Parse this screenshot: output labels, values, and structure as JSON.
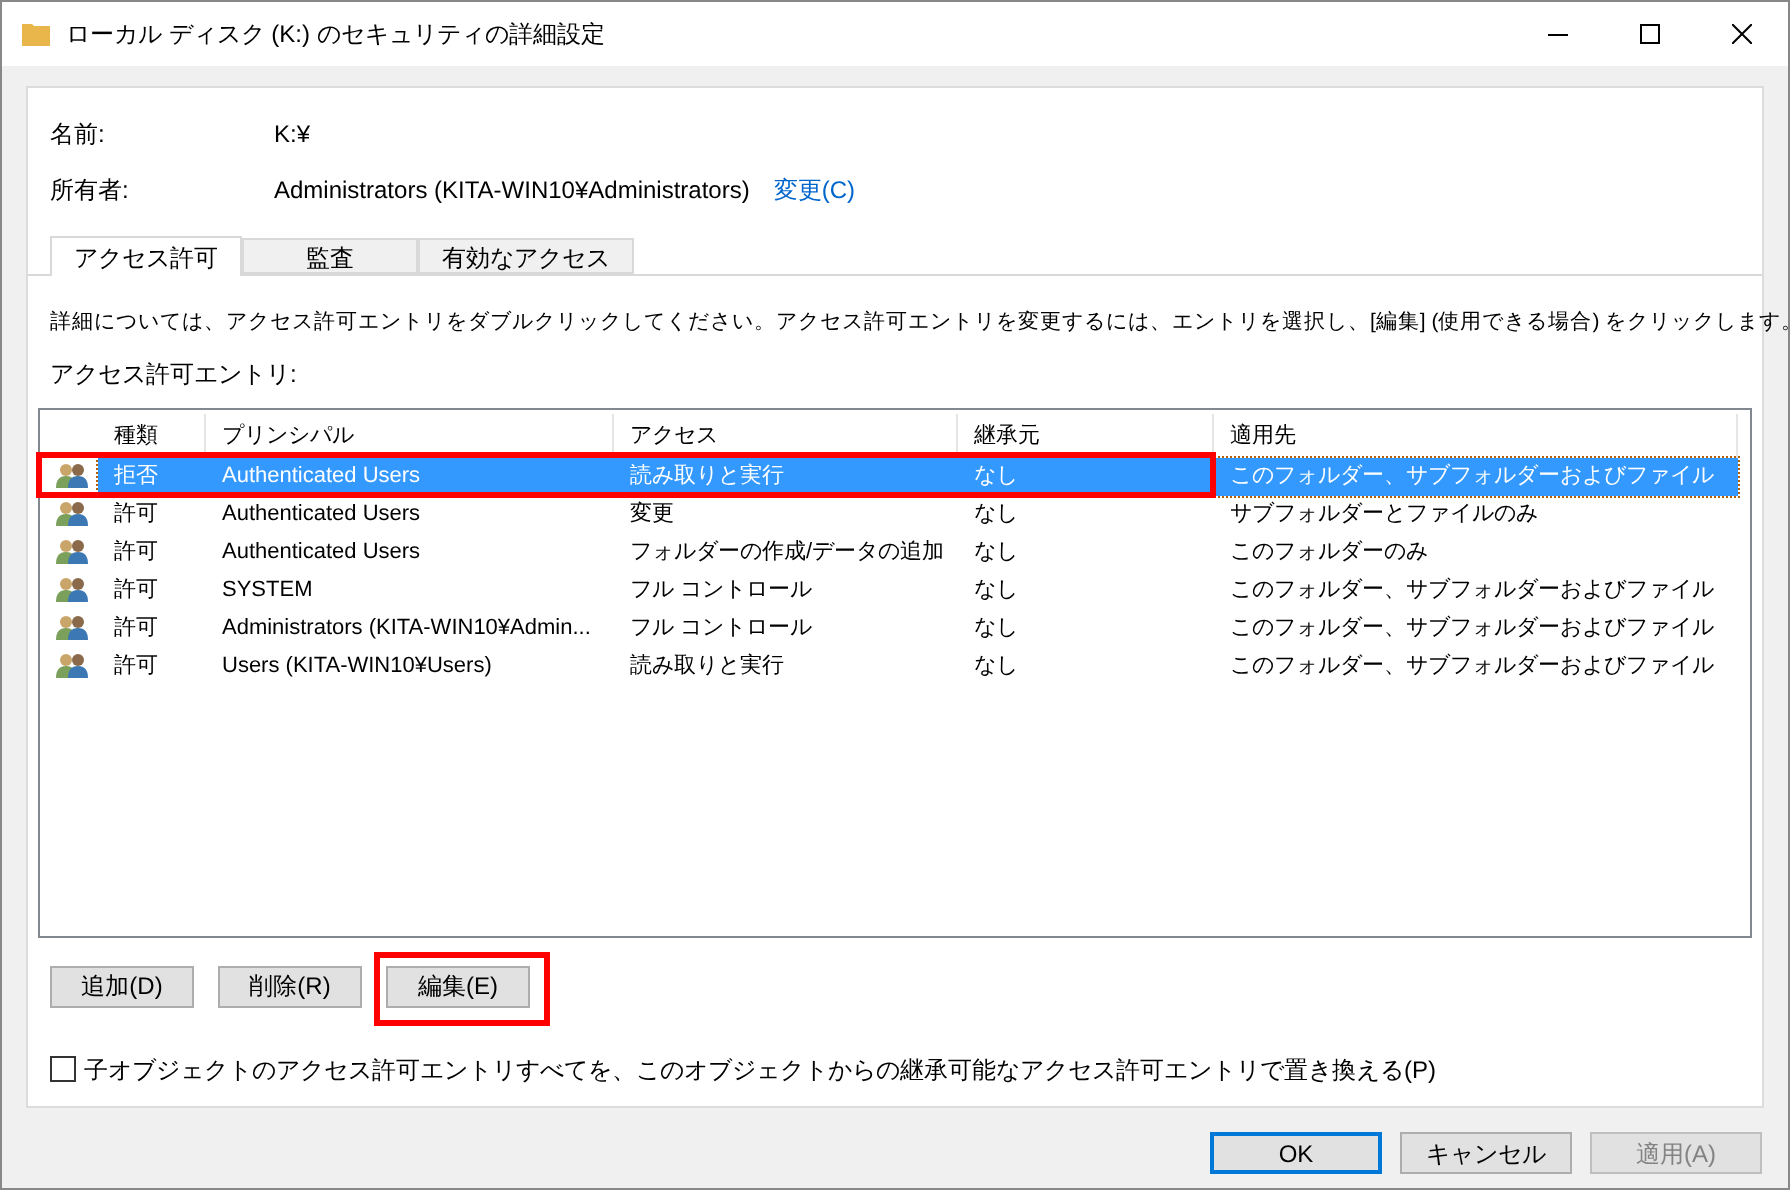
{
  "window": {
    "title": "ローカル ディスク (K:) のセキュリティの詳細設定"
  },
  "info": [
    {
      "label": "名前:",
      "value": "K:¥"
    },
    {
      "label": "所有者:",
      "value": "Administrators (KITA-WIN10¥Administrators)",
      "link": "変更(C)"
    }
  ],
  "tabs": [
    {
      "label": "アクセス許可",
      "selected": true
    },
    {
      "label": "監査",
      "selected": false
    },
    {
      "label": "有効なアクセス",
      "selected": false
    }
  ],
  "description": "詳細については、アクセス許可エントリをダブルクリックしてください。アクセス許可エントリを変更するには、エントリを選択し、[編集] (使用できる場合) をクリックします。",
  "list_label": "アクセス許可エントリ:",
  "table": {
    "columns": [
      "種類",
      "プリンシパル",
      "アクセス",
      "継承元",
      "適用先"
    ],
    "rows": [
      {
        "cells": [
          "拒否",
          "Authenticated Users",
          "読み取りと実行",
          "なし",
          "このフォルダー、サブフォルダーおよびファイル"
        ],
        "selected": true
      },
      {
        "cells": [
          "許可",
          "Authenticated Users",
          "変更",
          "なし",
          "サブフォルダーとファイルのみ"
        ],
        "selected": false
      },
      {
        "cells": [
          "許可",
          "Authenticated Users",
          "フォルダーの作成/データの追加",
          "なし",
          "このフォルダーのみ"
        ],
        "selected": false
      },
      {
        "cells": [
          "許可",
          "SYSTEM",
          "フル コントロール",
          "なし",
          "このフォルダー、サブフォルダーおよびファイル"
        ],
        "selected": false
      },
      {
        "cells": [
          "許可",
          "Administrators (KITA-WIN10¥Admin...",
          "フル コントロール",
          "なし",
          "このフォルダー、サブフォルダーおよびファイル"
        ],
        "selected": false
      },
      {
        "cells": [
          "許可",
          "Users (KITA-WIN10¥Users)",
          "読み取りと実行",
          "なし",
          "このフォルダー、サブフォルダーおよびファイル"
        ],
        "selected": false
      }
    ]
  },
  "entry_buttons": [
    {
      "label": "追加(D)",
      "disabled": false
    },
    {
      "label": "削除(R)",
      "disabled": false
    },
    {
      "label": "編集(E)",
      "disabled": false
    }
  ],
  "replace_checkbox": {
    "label": "子オブジェクトのアクセス許可エントリすべてを、このオブジェクトからの継承可能なアクセス許可エントリで置き換える(P)",
    "checked": false
  },
  "footer_buttons": [
    {
      "label": "OK",
      "disabled": false,
      "default": true
    },
    {
      "label": "キャンセル",
      "disabled": false,
      "default": false
    },
    {
      "label": "適用(A)",
      "disabled": true,
      "default": false
    }
  ]
}
